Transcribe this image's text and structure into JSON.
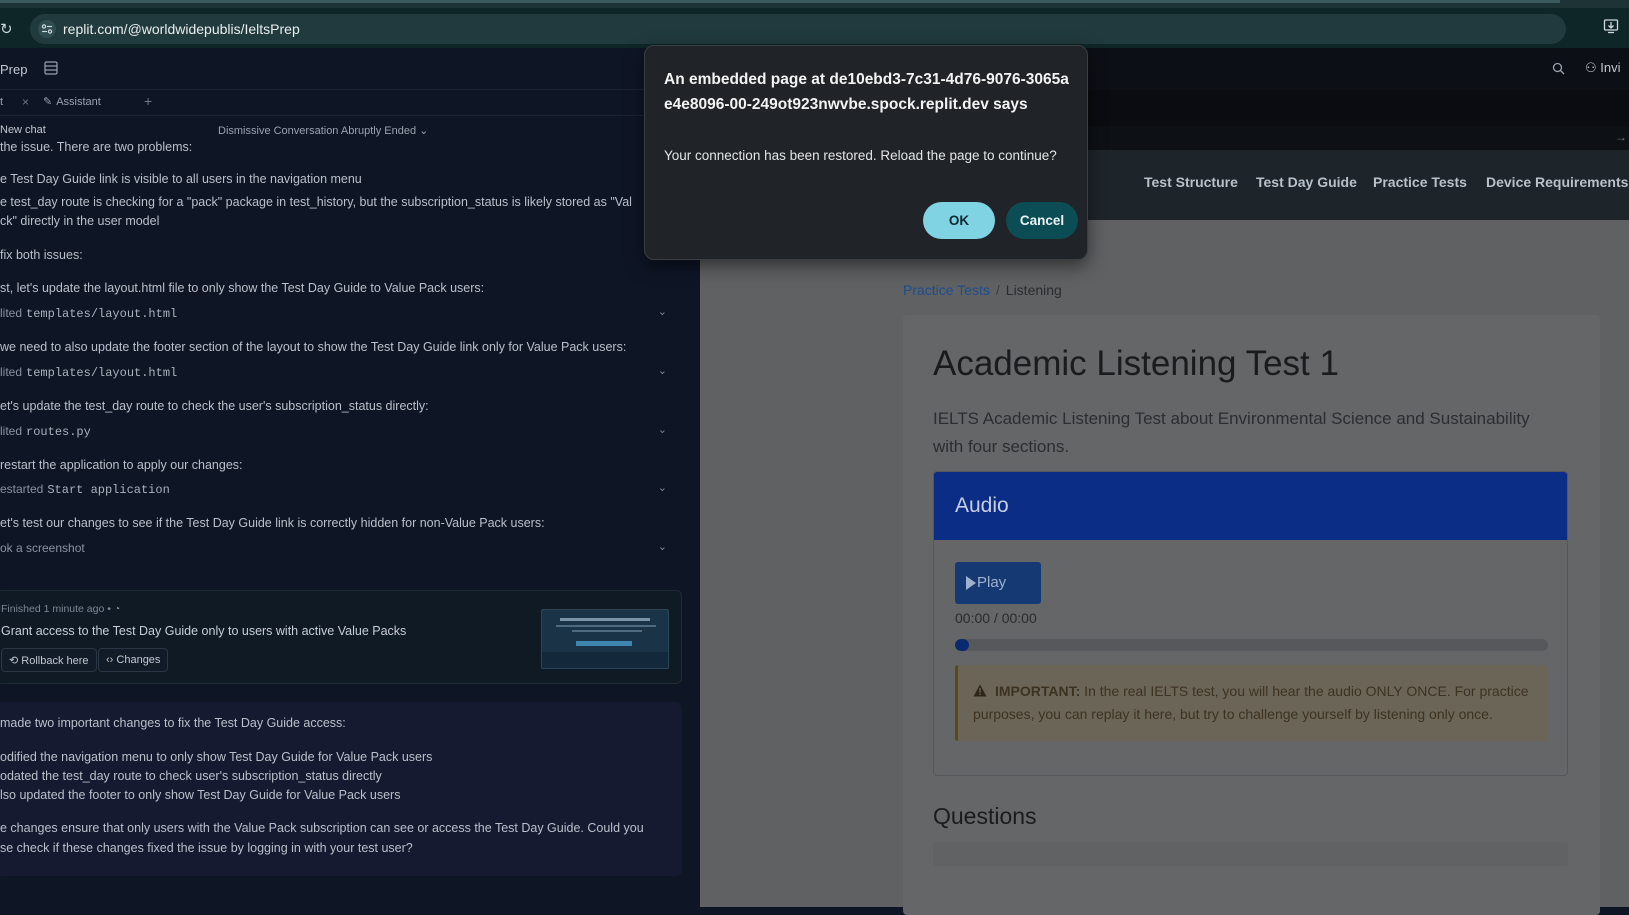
{
  "browser": {
    "url": "replit.com/@worldwidepublis/IeltsPrep"
  },
  "ide": {
    "app_name": "Prep",
    "tabs": [
      {
        "label": "t"
      },
      {
        "label": "Assistant"
      }
    ],
    "tab_add": "+",
    "new_chat": "New chat",
    "chat_title": "Dismissive Conversation Abruptly Ended ⌄",
    "messages": [
      "the issue. There are two problems:",
      "e Test Day Guide link is visible to all users in the navigation menu",
      "e test_day route is checking for a \"pack\" package in test_history, but the subscription_status is likely stored as \"Val",
      "ck\" directly in the user model",
      "fix both issues:",
      "st, let's update the layout.html file to only show the Test Day Guide to Value Pack users:",
      "we need to also update the footer section of the layout to show the Test Day Guide link only for Value Pack users:",
      "et's update the test_day route to check the user's subscription_status directly:",
      "restart the application to apply our changes:",
      "et's test our changes to see if the Test Day Guide link is correctly hidden for non-Value Pack users:"
    ],
    "steps": [
      {
        "label": "lited",
        "file": "templates/layout.html"
      },
      {
        "label": "lited",
        "file": "templates/layout.html"
      },
      {
        "label": "lited",
        "file": "routes.py"
      },
      {
        "label": "estarted",
        "file": "Start application"
      },
      {
        "label": "ok a screenshot",
        "file": ""
      }
    ],
    "finished": {
      "meta": "Finished 1 minute ago  •",
      "title": "Grant access to the Test Day Guide only to users with active Value Packs",
      "rollback": "Rollback here",
      "changes": "Changes"
    },
    "summary": [
      "made two important changes to fix the Test Day Guide access:",
      "odified the navigation menu to only show Test Day Guide for Value Pack users",
      "odated the test_day route to check user's subscription_status directly",
      "lso updated the footer to only show Test Day Guide for Value Pack users",
      "e changes ensure that only users with the Value Pack subscription can see or access the Test Day Guide. Could you",
      "se check if these changes fixed the issue by logging in with your test user?"
    ]
  },
  "preview": {
    "invite": "Invi",
    "nav": [
      "Test Structure",
      "Test Day Guide",
      "Practice Tests",
      "Device Requirements"
    ],
    "breadcrumb": {
      "link": "Practice Tests",
      "sep": "/",
      "current": "Listening"
    },
    "title": "Academic Listening Test 1",
    "description": "IELTS Academic Listening Test about Environmental Science and Sustainability with four sections.",
    "audio": {
      "heading": "Audio",
      "play": "Play",
      "time": "00:00 / 00:00",
      "progress": 0.0,
      "important_label": "IMPORTANT:",
      "important_text": " In the real IELTS test, you will hear the audio ONLY ONCE. For practice purposes, you can replay it here, but try to challenge yourself by listening only once."
    },
    "questions_heading": "Questions"
  },
  "dialog": {
    "title": "An embedded page at de10ebd3-7c31-4d76-9076-3065ae4e8096-00-249ot923nwvbe.spock.replit.dev says",
    "message": "Your connection has been restored. Reload the page to continue?",
    "ok": "OK",
    "cancel": "Cancel"
  },
  "colors": {
    "dialog_ok": "#7fd3e2",
    "dialog_cancel": "#0c4c55",
    "audio_header": "#0b2d86"
  }
}
